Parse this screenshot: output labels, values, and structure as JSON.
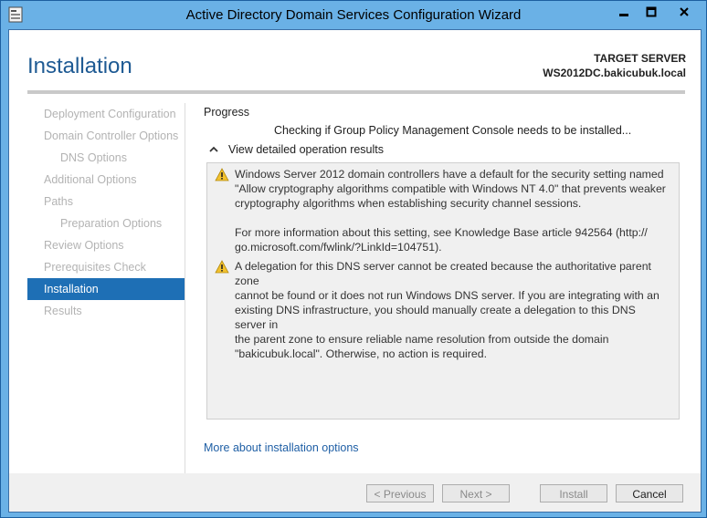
{
  "window": {
    "title": "Active Directory Domain Services Configuration Wizard"
  },
  "header": {
    "page_title": "Installation",
    "target_server_label": "TARGET SERVER",
    "target_server_name": "WS2012DC.bakicubuk.local"
  },
  "nav": {
    "items": [
      {
        "label": "Deployment Configuration"
      },
      {
        "label": "Domain Controller Options"
      },
      {
        "label": "DNS Options"
      },
      {
        "label": "Additional Options"
      },
      {
        "label": "Paths"
      },
      {
        "label": "Preparation Options"
      },
      {
        "label": "Review Options"
      },
      {
        "label": "Prerequisites Check"
      },
      {
        "label": "Installation"
      },
      {
        "label": "Results"
      }
    ]
  },
  "main": {
    "progress_label": "Progress",
    "status_text": "Checking if Group Policy Management Console needs to be installed...",
    "toggle_label": "View detailed operation results",
    "messages": [
      {
        "icon": "warning-icon",
        "lines": [
          "Windows Server 2012 domain controllers have a default for the security setting named",
          "\"Allow cryptography algorithms compatible with Windows NT 4.0\" that prevents weaker",
          "cryptography algorithms when establishing security channel sessions.",
          "",
          "For more information about this setting, see Knowledge Base article 942564 (http://",
          "go.microsoft.com/fwlink/?LinkId=104751)."
        ]
      },
      {
        "icon": "warning-icon",
        "lines": [
          "A delegation for this DNS server cannot be created because the authoritative parent zone",
          "cannot be found or it does not run Windows DNS server. If you are integrating with an",
          "existing DNS infrastructure, you should manually create a delegation to this DNS server in",
          "the parent zone to ensure reliable name resolution from outside the domain",
          "\"bakicubuk.local\". Otherwise, no action is required."
        ]
      }
    ],
    "more_link": "More about installation options"
  },
  "footer": {
    "previous": "< Previous",
    "next": "Next >",
    "install": "Install",
    "cancel": "Cancel"
  },
  "colors": {
    "titlebar": "#6ab1e6",
    "accent": "#1e6fb5",
    "heading": "#1e5a93",
    "link": "#1f5fa5"
  }
}
